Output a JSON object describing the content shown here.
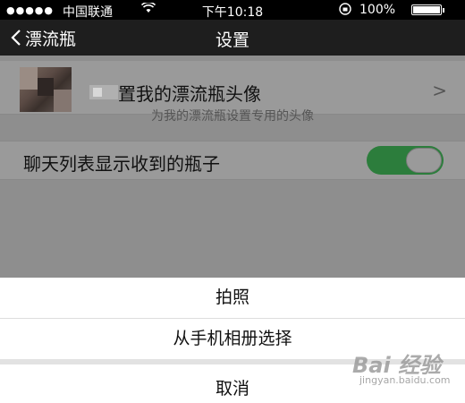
{
  "status_bar": {
    "signal": "●●●●●",
    "carrier": "中国联通",
    "wifi_icon": "wifi-icon",
    "time": "下午10:18",
    "battery_percent": "100%"
  },
  "nav": {
    "back_label": "漂流瓶",
    "title": "设置"
  },
  "settings": {
    "avatar_row_label": "置我的漂流瓶头像",
    "avatar_hint": "为我的漂流瓶设置专用的头像",
    "chevron": ">",
    "toggle_label": "聊天列表显示收到的瓶子",
    "toggle_on": true
  },
  "action_sheet": {
    "items": [
      "拍照",
      "从手机相册选择"
    ],
    "cancel": "取消"
  },
  "watermark": {
    "main": "Bai 经验",
    "sub": "jingyan.baidu.com"
  },
  "colors": {
    "toggle_on": "#2c7d3c",
    "nav_bg": "#1e1e1e",
    "overlay_bg": "#8e8e8e"
  }
}
